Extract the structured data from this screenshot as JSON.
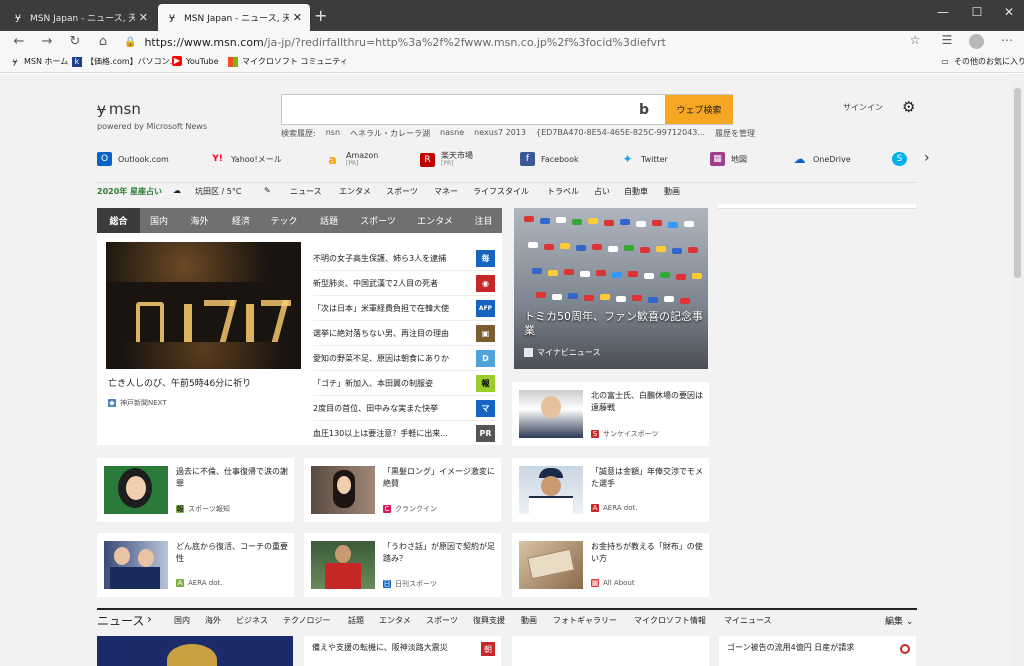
{
  "browser": {
    "tabs": [
      {
        "title": "MSN Japan - ニュース, 天気, メール",
        "active": false
      },
      {
        "title": "MSN Japan - ニュース, 天気, メール",
        "active": true
      }
    ],
    "url_host": "https://www.msn.com",
    "url_path": "/ja-jp/?redirfallthru=http%3a%2f%2fwww.msn.co.jp%2f%3focid%3diefvrt",
    "bookmarks": [
      "MSN ホーム",
      "【価格.com】パソコン...",
      "YouTube",
      "マイクロソフト コミュニティ"
    ],
    "other_favorites": "その他のお気に入り"
  },
  "header": {
    "logo_text": "msn",
    "powered_by": "powered by Microsoft News",
    "search_button": "ウェブ検索",
    "signin": "サインイン",
    "history_label": "検索履歴:",
    "history_items": [
      "nsn",
      "ヘネラル・カレーラ湖",
      "nasne",
      "nexus7 2013",
      "{ED7BA470-8E54-465E-825C-99712043..."
    ],
    "history_manage": "履歴を管理"
  },
  "shortcuts": [
    {
      "label": "Outlook.com",
      "icon": "outlook-icon",
      "color": "#0a64c8",
      "glyph": "O"
    },
    {
      "label": "Yahoo!メール",
      "icon": "yahoo-icon",
      "color": "#ff0033",
      "glyph": "Y!"
    },
    {
      "label": "Amazon",
      "pr": "[PR]",
      "icon": "amazon-icon",
      "color": "#ff9900",
      "glyph": "a"
    },
    {
      "label": "楽天市場",
      "pr": "[PR]",
      "icon": "rakuten-icon",
      "color": "#bf0000",
      "glyph": "R"
    },
    {
      "label": "Facebook",
      "icon": "facebook-icon",
      "color": "#3b5998",
      "glyph": "f"
    },
    {
      "label": "Twitter",
      "icon": "twitter-icon",
      "color": "#1da1f2",
      "glyph": "t"
    },
    {
      "label": "地図",
      "icon": "map-icon",
      "color": "#a0408c",
      "glyph": "▦"
    },
    {
      "label": "OneDrive",
      "icon": "onedrive-icon",
      "color": "#0a64c8",
      "glyph": "☁"
    },
    {
      "label": "",
      "icon": "skype-icon",
      "color": "#00aff0",
      "glyph": "S"
    }
  ],
  "navrow": {
    "fortune": "2020年 星座占い",
    "weather": "坑田区 / 5°C",
    "links": [
      "ニュース",
      "エンタメ",
      "スポーツ",
      "マネー",
      "ライフスタイル",
      "トラベル",
      "占い",
      "自動車",
      "動画"
    ]
  },
  "category_tabs": [
    "総合",
    "国内",
    "海外",
    "経済",
    "テック",
    "話題",
    "スポーツ",
    "エンタメ",
    "注目"
  ],
  "main_story": {
    "headline": "亡き人しのび、午前5時46分に祈り",
    "source": "神戸新聞NEXT"
  },
  "news_list": [
    {
      "text": "不明の女子高生保護、姉ら3人を逮捕",
      "badge": "毎",
      "color": "#1565c0"
    },
    {
      "text": "新型肺炎、中国武漢で2人目の死者",
      "badge": "◉",
      "color": "#c62828"
    },
    {
      "text": "「次は日本」米軍経費負担で在韓大使",
      "badge": "AFP",
      "color": "#1565c0"
    },
    {
      "text": "選挙に絶対落ちない男、再注目の理由",
      "badge": "▣",
      "color": "#7a5c2e"
    },
    {
      "text": "愛知の野菜不足、原因は朝食にありか",
      "badge": "D",
      "color": "#4fa3d9"
    },
    {
      "text": "「ゴチ」新加入、本田翼の制服姿",
      "badge": "報",
      "color": "#9ccc2c"
    },
    {
      "text": "2度目の首位、田中みな実また快挙",
      "badge": "マ",
      "color": "#1565c0"
    },
    {
      "text": "血圧130以上は要注意？手軽に出来...",
      "badge": "PR",
      "color": "#555555"
    }
  ],
  "feature": {
    "caption": "トミカ50周年、ファン歓喜の記念事業",
    "source": "マイナビニュース"
  },
  "cards": [
    {
      "text": "北の富士氏、白鵬休場の要因は遠藤戦",
      "source": "サンケイスポーツ"
    },
    {
      "text": "過去に不倫、仕事復帰で涙の謝罪",
      "source": "スポーツ報知"
    },
    {
      "text": "「黒髪ロング」イメージ激変に絶賛",
      "source": "クランクイン"
    },
    {
      "text": "「誠意は金額」年俸交渉でモメた選手",
      "source": "AERA dot."
    },
    {
      "text": "どん底から復活、コーチの重要性",
      "source": "AERA dot."
    },
    {
      "text": "「うわさ話」が原因で契約が足踏み？",
      "source": "日刊スポーツ"
    },
    {
      "text": "お金持ちが教える「財布」の使い方",
      "source": "All About"
    }
  ],
  "bottom": {
    "section": "ニュース",
    "links": [
      "国内",
      "海外",
      "ビジネス",
      "テクノロジー",
      "話題",
      "エンタメ",
      "スポーツ",
      "復興支援",
      "動画",
      "フォトギャラリー",
      "マイクロソフト情報",
      "マイニュース"
    ],
    "edit": "編集",
    "story1": "備えや支援の転機に、阪神淡路大震災",
    "story2": "ゴーン被告の流用4億円 日産が請求"
  }
}
